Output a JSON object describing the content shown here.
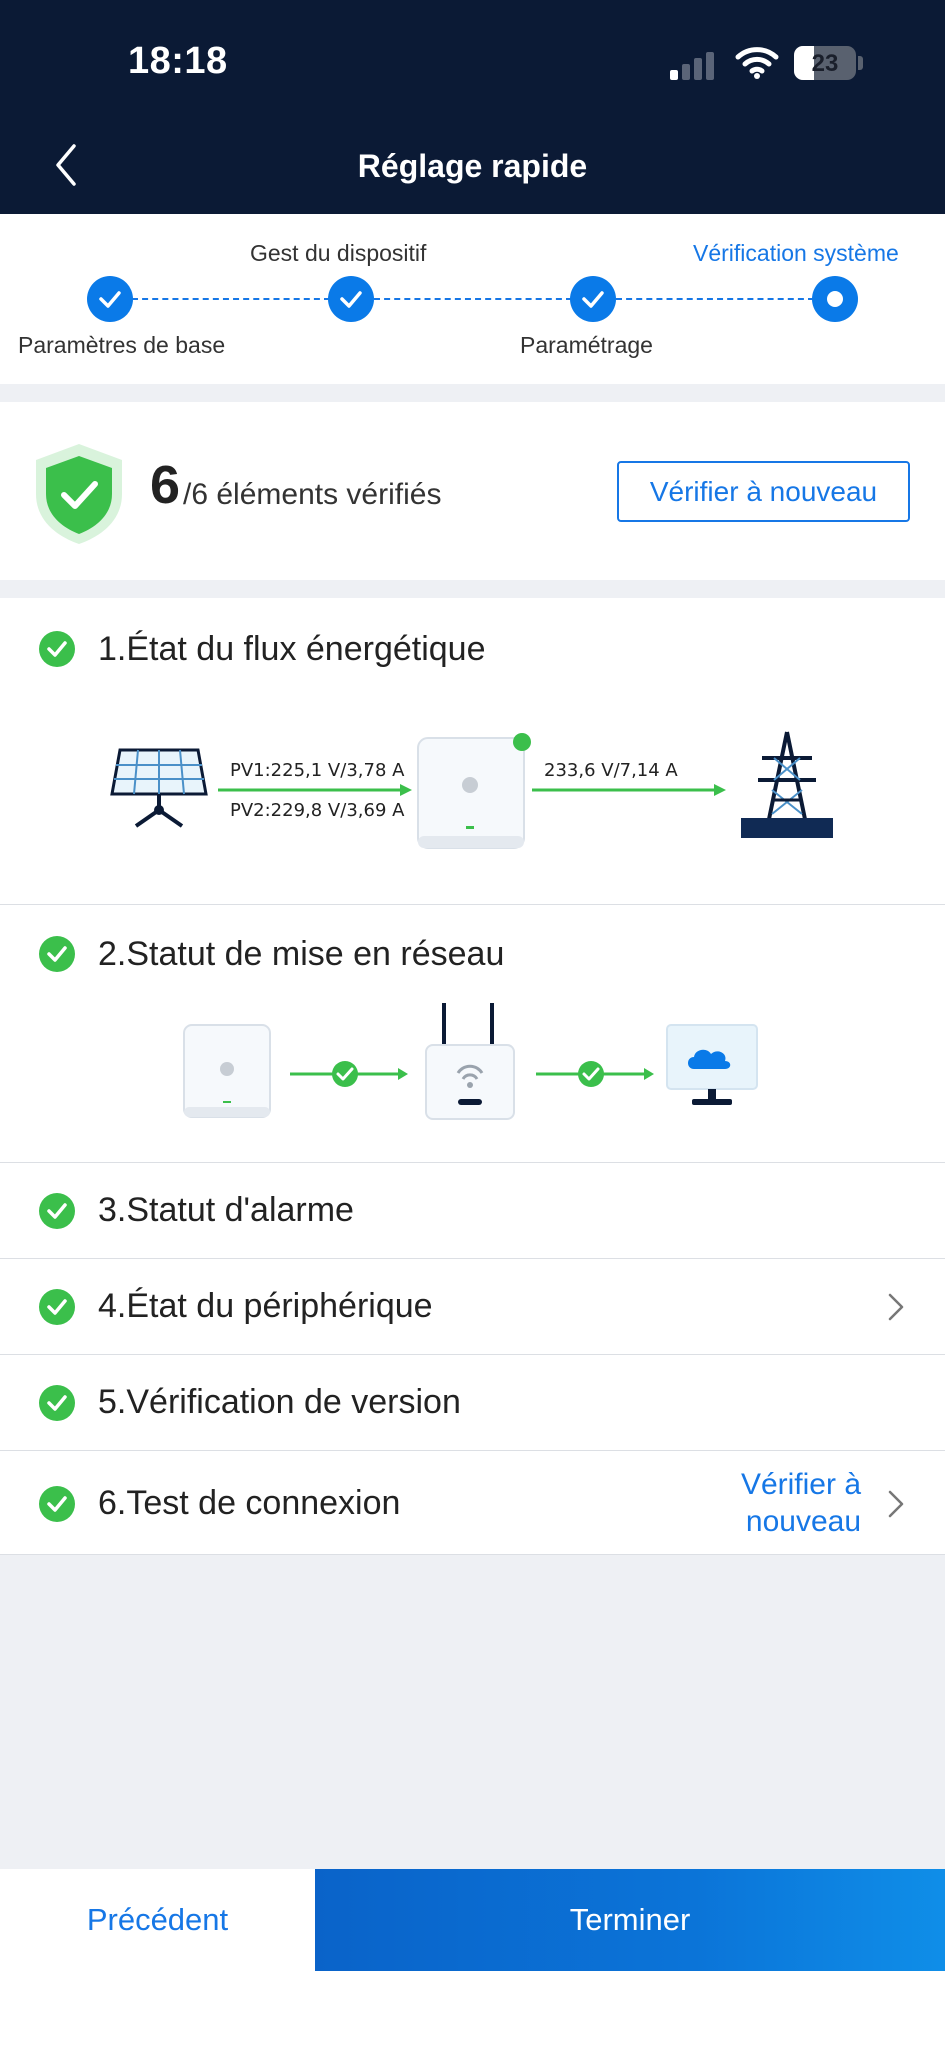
{
  "status_bar": {
    "time": "18:18",
    "battery": "23"
  },
  "header": {
    "title": "Réglage rapide"
  },
  "stepper": {
    "steps": [
      {
        "label": "Paramètres de base",
        "state": "done"
      },
      {
        "label": "Gest du dispositif",
        "state": "done"
      },
      {
        "label": "Paramétrage",
        "state": "done"
      },
      {
        "label": "Vérification système",
        "state": "current"
      }
    ]
  },
  "summary": {
    "count": "6",
    "rest": "/6 éléments vérifiés",
    "recheck_label": "Vérifier à nouveau"
  },
  "checks": [
    {
      "label": "1.État du flux énergétique",
      "pv1": "PV1:225,1 V/3,78 A",
      "pv2": "PV2:229,8 V/3,69 A",
      "grid": "233,6 V/7,14 A"
    },
    {
      "label": "2.Statut de mise en réseau"
    },
    {
      "label": "3.Statut d'alarme"
    },
    {
      "label": "4.État du périphérique"
    },
    {
      "label": "5.Vérification de version"
    },
    {
      "label": "6.Test de connexion",
      "link_line1": "Vérifier à",
      "link_line2": "nouveau"
    }
  ],
  "footer": {
    "prev_label": "Précédent",
    "finish_label": "Terminer"
  },
  "colors": {
    "accent": "#1677e6",
    "success": "#3bbf4b",
    "header_bg": "#0b1a35"
  }
}
